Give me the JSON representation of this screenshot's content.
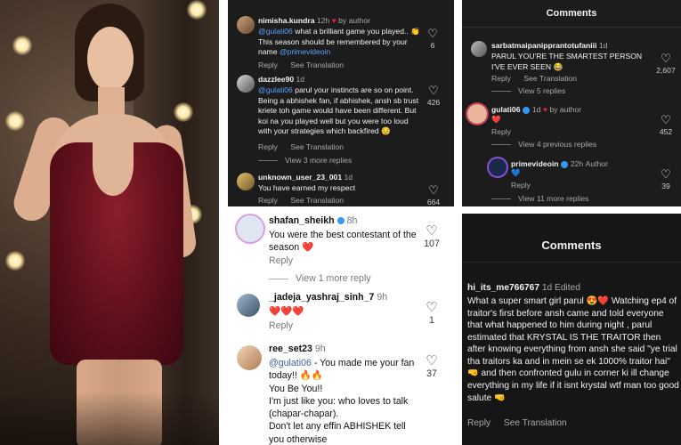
{
  "panel_top_center": {
    "comments": [
      {
        "username": "nimisha.kundra",
        "time": "12h",
        "by_author": "by author",
        "text_mention": "@gulati06",
        "text": " what a brilliant game you played.. 👏 This season should be remembered by your name ",
        "text_mention2": "@primevideoin",
        "reply": "Reply",
        "translate": "See Translation",
        "likes": "6"
      },
      {
        "username": "dazzlee90",
        "time": "1d",
        "text_mention": "@gulati06",
        "text": " parul your instincts are so on point. Being a abhishek fan, if abhishek, ansh sb trust kriete toh game would have been different. But koi na you played well but you were too loud with your strategies which backfired 😔",
        "reply": "Reply",
        "translate": "See Translation",
        "likes": "426",
        "view_replies": "View 3 more replies"
      },
      {
        "username": "unknown_user_23_001",
        "time": "1d",
        "text": "You have earned my respect",
        "reply": "Reply",
        "translate": "See Translation",
        "likes": "664"
      }
    ]
  },
  "panel_top_right": {
    "title": "Comments",
    "comments": [
      {
        "username": "sarbatmaipanipprantotufaniii",
        "time": "1d",
        "text": "PARUL YOU'RE THE SMARTEST PERSON I'VE EVER SEEN 😂",
        "reply": "Reply",
        "translate": "See Translation",
        "likes": "2,607",
        "view_replies": "View 5 replies"
      },
      {
        "username": "gulati06",
        "time": "1d",
        "by_author": "by author",
        "text": "❤️",
        "reply": "Reply",
        "likes": "452",
        "view_replies": "View 4 previous replies"
      },
      {
        "username": "primevideoin",
        "time": "22h",
        "author_tag": "Author",
        "text": "💙",
        "reply": "Reply",
        "likes": "39",
        "view_replies": "View 11 more replies"
      }
    ]
  },
  "panel_bottom_center": {
    "comments": [
      {
        "username": "shafan_sheikh",
        "time": "8h",
        "text": "You were the best contestant of the season ❤️",
        "reply": "Reply",
        "likes": "107",
        "view_replies": "View 1 more reply"
      },
      {
        "username": "_jadeja_yashraj_sinh_7",
        "time": "9h",
        "text": "❤️❤️❤️",
        "reply": "Reply",
        "likes": "1"
      },
      {
        "username": "ree_set23",
        "time": "9h",
        "text_mention": "@gulati06",
        "text": " - You made me your fan today!! 🔥🔥\nYou Be You!!\nI'm just like you: who loves to talk (chapar-chapar).\nDon't let any effin ABHISHEK tell you otherwise",
        "likes": "37"
      }
    ]
  },
  "panel_bottom_right": {
    "title": "Comments",
    "comment": {
      "username": "hi_its_me766767",
      "time": "1d",
      "edited": "Edited",
      "text": "What a super smart girl parul 😍❤️ Watching ep4 of traitor's first before ansh came and told everyone that what happened to him during night , parul estimated that KRYSTAL IS THE TRAITOR then after knowing everything from ansh she said \"ye trial tha traitors ka and in mein se ek 1000% traitor hai\" 🤜 and then confronted gulu in corner ki ill change everything in my life if it isnt krystal wtf man too good salute 🤜",
      "reply": "Reply",
      "translate": "See Translation"
    }
  },
  "icons": {
    "heart_outline": "♡",
    "heart_red": "♥"
  },
  "colors": {
    "dark_bg": "#1c1c1c",
    "mention_dark": "#5aa2ff",
    "mention_light": "#3b5f9e",
    "verified": "#3897f0",
    "heart_red": "#e0233c"
  }
}
